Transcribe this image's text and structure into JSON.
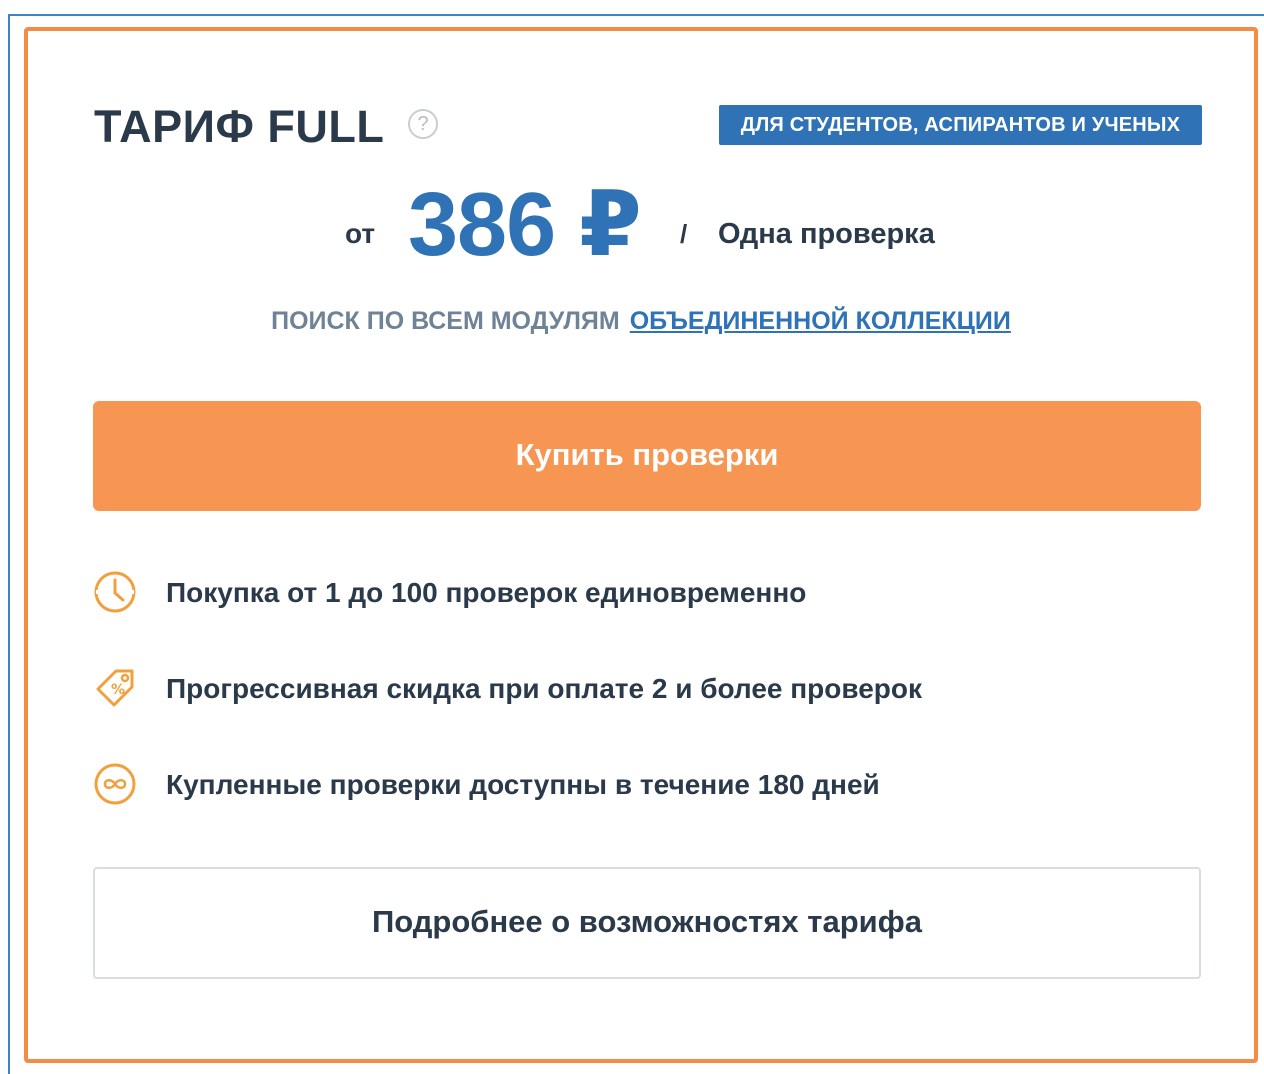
{
  "tariff": {
    "title": "ТАРИФ FULL",
    "help_icon": "question-circle-icon",
    "badge": "для студентов, аспирантов и ученых"
  },
  "price": {
    "from": "от",
    "amount": "386 ₽",
    "separator": "/",
    "unit": "Одна проверка"
  },
  "search": {
    "text": "поиск по всем модулям",
    "link": "объединенной коллекции"
  },
  "buy_button": "Купить проверки",
  "features": [
    {
      "icon": "clock-icon",
      "text": "Покупка от 1 до 100 проверок единовременно"
    },
    {
      "icon": "discount-tag-icon",
      "text": "Прогрессивная скидка при оплате 2 и более проверок"
    },
    {
      "icon": "infinity-icon",
      "text": "Купленные проверки доступны в течение 180 дней"
    }
  ],
  "more_button": "Подробнее о возможностях тарифа",
  "colors": {
    "accent_orange": "#f79552",
    "border_orange": "#f48c45",
    "brand_blue": "#2f73b6",
    "text_dark": "#2b3a4a",
    "text_muted": "#6f8396"
  }
}
